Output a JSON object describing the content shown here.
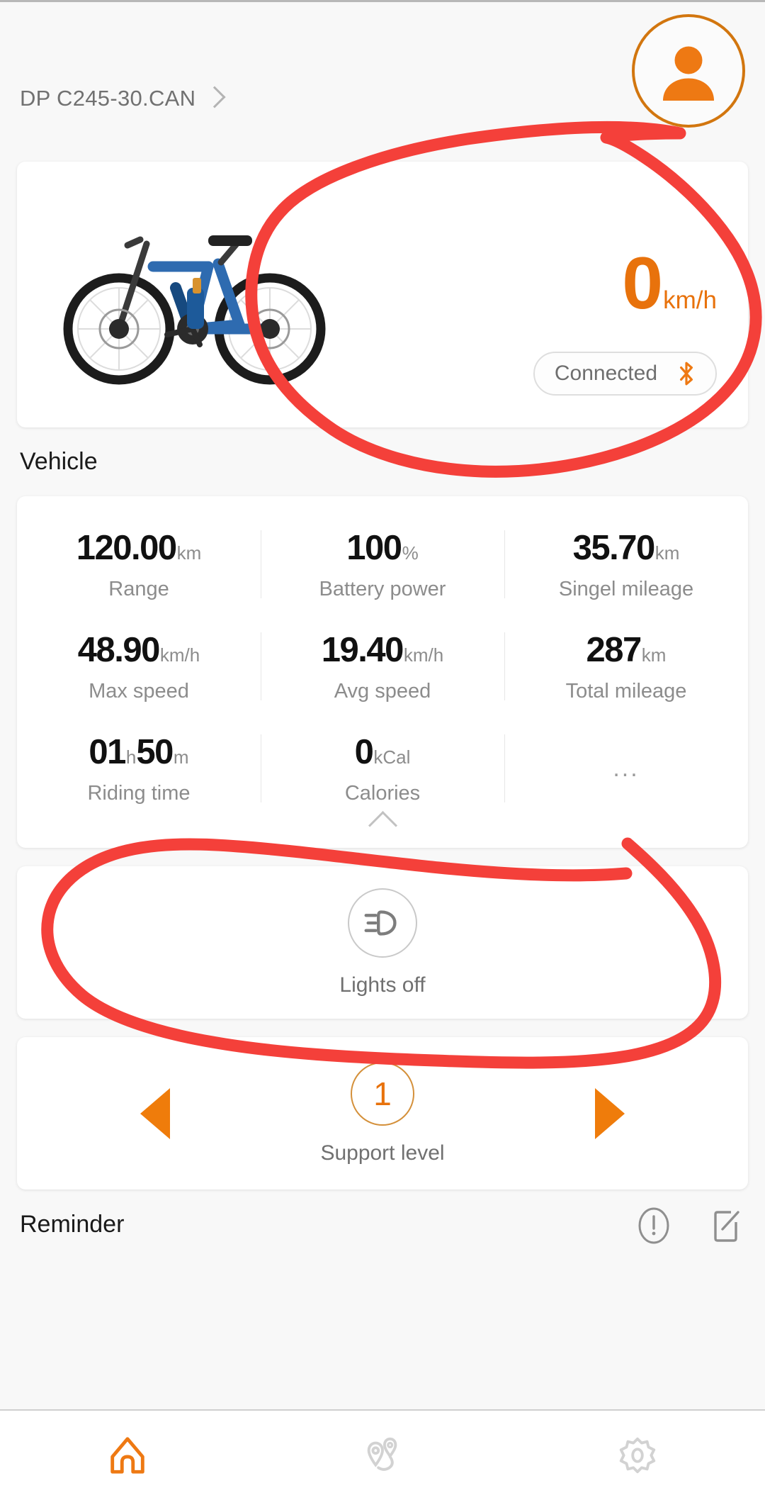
{
  "header": {
    "device_name": "DP C245-30.CAN",
    "chevron_icon": "chevron-right-icon",
    "avatar_icon": "user-avatar-icon"
  },
  "hero": {
    "bike_image_alt": "blue electric mountain bike",
    "speed_value": "0",
    "speed_unit": "km/h",
    "connection_status": "Connected",
    "bluetooth_icon": "bluetooth-icon"
  },
  "sections": {
    "vehicle_label": "Vehicle",
    "reminder_label": "Reminder"
  },
  "stats": {
    "rows": [
      [
        {
          "value": "120.00",
          "unit": "km",
          "name": "Range"
        },
        {
          "value": "100",
          "unit": "%",
          "name": "Battery power"
        },
        {
          "value": "35.70",
          "unit": "km",
          "name": "Singel mileage"
        }
      ],
      [
        {
          "value": "48.90",
          "unit": "km/h",
          "name": "Max speed"
        },
        {
          "value": "19.40",
          "unit": "km/h",
          "name": "Avg speed"
        },
        {
          "value": "287",
          "unit": "km",
          "name": "Total mileage"
        }
      ],
      [
        {
          "value": "01",
          "unit": "h",
          "value2": "50",
          "unit2": "m",
          "name": "Riding time"
        },
        {
          "value": "0",
          "unit": "kCal",
          "name": "Calories"
        },
        {
          "placeholder": "..."
        }
      ]
    ],
    "collapse_icon": "chevron-up-icon"
  },
  "lights": {
    "icon": "headlight-icon",
    "label": "Lights off"
  },
  "support": {
    "prev_icon": "triangle-left-icon",
    "level": "1",
    "next_icon": "triangle-right-icon",
    "label": "Support level"
  },
  "reminder": {
    "alert_icon": "alert-circle-icon",
    "edit_icon": "edit-note-icon"
  },
  "nav": {
    "items": [
      {
        "icon": "home-icon",
        "active": true
      },
      {
        "icon": "route-pin-icon",
        "active": false
      },
      {
        "icon": "gear-icon",
        "active": false
      }
    ]
  },
  "annotations": {
    "stroke_color": "#f4403a",
    "marks": [
      {
        "name": "speed-area-circle",
        "shape": "hand-drawn-ellipse"
      },
      {
        "name": "lights-card-circle",
        "shape": "hand-drawn-lasso"
      }
    ]
  },
  "colors": {
    "accent_orange": "#e8720c",
    "background": "#f8f8f8",
    "card": "#ffffff",
    "annotation_red": "#f4403a"
  }
}
